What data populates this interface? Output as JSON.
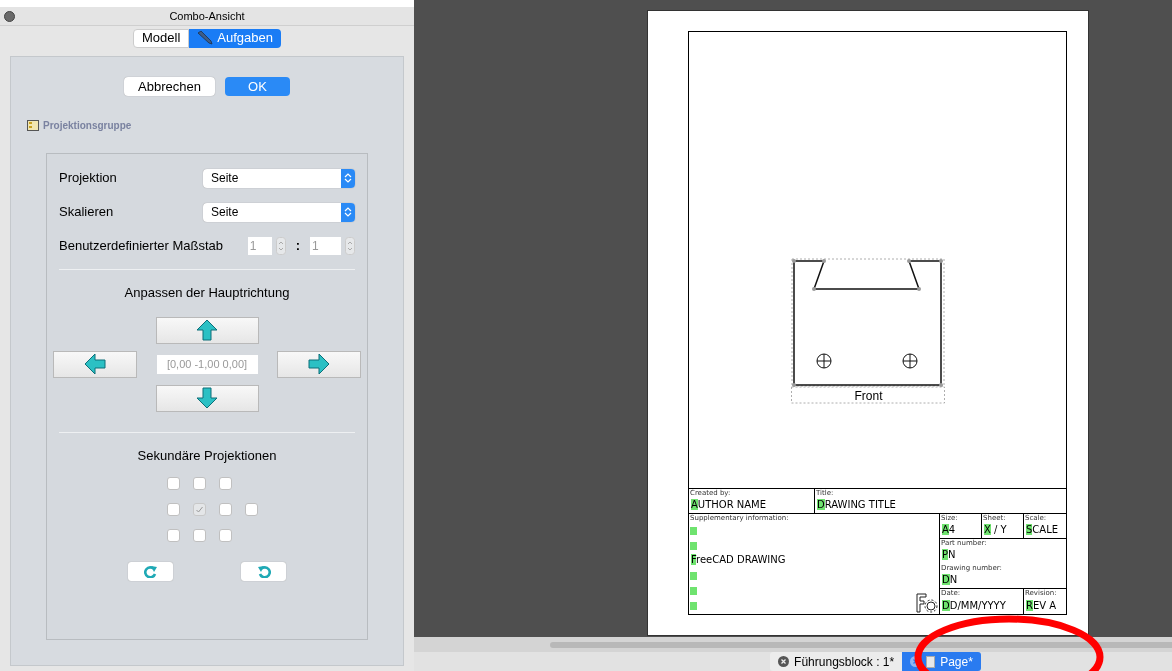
{
  "panel": {
    "title": "Combo-Ansicht",
    "tabs": [
      {
        "label": "Modell",
        "selected": false
      },
      {
        "label": "Aufgaben",
        "selected": true
      }
    ],
    "buttons": {
      "cancel": "Abbrechen",
      "ok": "OK"
    },
    "group_title": "Projektionsgruppe",
    "fields": [
      {
        "kind": "select",
        "label": "Projektion",
        "value": "Seite"
      },
      {
        "kind": "select",
        "label": "Skalieren",
        "value": "Seite"
      },
      {
        "kind": "ratio",
        "label": "Benutzerdefinierter Maßstab",
        "value": "1",
        "separator": ":",
        "value2": "1"
      }
    ],
    "direction": {
      "heading": "Anpassen der Hauptrichtung",
      "value": "[0,00 -1,00 0,00]"
    },
    "secondary": {
      "heading": "Sekundäre Projektionen",
      "rows": [
        [
          {
            "checked": false,
            "disabled": false
          },
          {
            "checked": false,
            "disabled": false
          },
          {
            "checked": false,
            "disabled": false
          }
        ],
        [
          {
            "checked": false,
            "disabled": false
          },
          {
            "checked": true,
            "disabled": true
          },
          {
            "checked": false,
            "disabled": false
          },
          {
            "checked": false,
            "disabled": false
          }
        ],
        [
          {
            "checked": false,
            "disabled": false
          },
          {
            "checked": false,
            "disabled": false
          },
          {
            "checked": false,
            "disabled": false
          }
        ]
      ]
    }
  },
  "sheet": {
    "view_label": "Front",
    "title_block": {
      "created_by": {
        "label": "Created by:",
        "value": "AUTHOR NAME"
      },
      "title": {
        "label": "Title:",
        "value": "DRAWING TITLE"
      },
      "supplementary": {
        "label": "Supplementary information:",
        "lines": [
          {
            "kind": "empty"
          },
          {
            "kind": "empty"
          },
          {
            "kind": "text",
            "text": "FreeCAD DRAWING"
          },
          {
            "kind": "empty"
          },
          {
            "kind": "empty"
          },
          {
            "kind": "empty"
          }
        ]
      },
      "size": {
        "label": "Size:",
        "value": "A4"
      },
      "sheet": {
        "label": "Sheet:",
        "value": "X / Y"
      },
      "scale": {
        "label": "Scale:",
        "value": "SCALE"
      },
      "part_number": {
        "label": "Part number:",
        "value": "PN"
      },
      "drawing_number": {
        "label": "Drawing number:",
        "value": "DN"
      },
      "date": {
        "label": "Date:",
        "value": "DD/MM/YYYY"
      },
      "revision": {
        "label": "Revision:",
        "value": "REV A"
      }
    }
  },
  "doc_tabs": [
    {
      "label": "Führungsblock : 1*",
      "selected": false
    },
    {
      "label": "Page*",
      "selected": true
    }
  ]
}
